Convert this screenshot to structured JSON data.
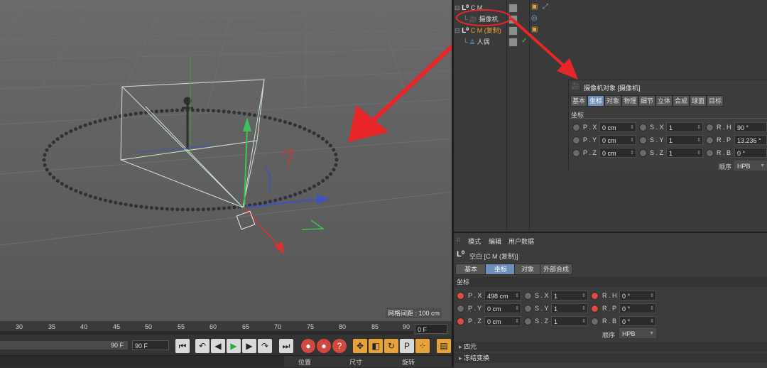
{
  "viewport": {
    "grid_spacing_label": "网格间距 : 100 cm"
  },
  "timeline": {
    "ticks": [
      "30",
      "35",
      "40",
      "45",
      "50",
      "55",
      "60",
      "65",
      "70",
      "75",
      "80",
      "85",
      "90"
    ],
    "current_frame": "0 F",
    "range_bar_value": "90 F",
    "range_end": "90 F"
  },
  "transport": {
    "buttons": [
      "go-start",
      "prev-key",
      "prev-frame",
      "play",
      "next-frame",
      "next-key",
      "go-end"
    ]
  },
  "coord_header": {
    "position": "位置",
    "size": "尺寸",
    "rotation": "旋转"
  },
  "object_manager": {
    "rows": [
      {
        "name": "C M",
        "highlight": false
      },
      {
        "name": "摄像机",
        "highlight": false
      },
      {
        "name": "C M (复制)",
        "highlight": true
      },
      {
        "name": "人偶",
        "highlight": false
      }
    ]
  },
  "camera_panel": {
    "title": "摄像机对象 [摄像机]",
    "tabs": [
      "基本",
      "坐标",
      "对象",
      "物理",
      "细节",
      "立体",
      "合成",
      "球面",
      "目标"
    ],
    "selected_tab": 1,
    "section": "坐标",
    "fields": {
      "px_label": "P . X",
      "px": "0 cm",
      "py_label": "P . Y",
      "py": "0 cm",
      "pz_label": "P . Z",
      "pz": "0 cm",
      "sx_label": "S . X",
      "sx": "1",
      "sy_label": "S . Y",
      "sy": "1",
      "sz_label": "S . Z",
      "sz": "1",
      "rh_label": "R . H",
      "rh": "90 °",
      "rp_label": "R . P",
      "rp": "13.236 °",
      "rb_label": "R . B",
      "rb": "0 °"
    },
    "order_label": "顺序",
    "order_value": "HPB"
  },
  "attribute_manager": {
    "menu": [
      "模式",
      "编辑",
      "用户数据"
    ],
    "object_title": "空白 [C M (复制)]",
    "tabs": [
      "基本",
      "坐标",
      "对象",
      "外部合成"
    ],
    "selected_tab": 1,
    "section": "坐标",
    "fields": {
      "px_label": "P . X",
      "px": "498 cm",
      "py_label": "P . Y",
      "py": "0 cm",
      "pz_label": "P . Z",
      "pz": "0 cm",
      "sx_label": "S . X",
      "sx": "1",
      "sy_label": "S . Y",
      "sy": "1",
      "sz_label": "S . Z",
      "sz": "1",
      "rh_label": "R . H",
      "rh": "0 °",
      "rp_label": "R . P",
      "rp": "0 °",
      "rb_label": "R . B",
      "rb": "0 °"
    },
    "order_label": "顺序",
    "order_value": "HPB",
    "collapsed_sections": [
      "四元",
      "冻结变换"
    ]
  },
  "colors": {
    "selected_tab": "#6f8fb8",
    "annotation_red": "#e8262a",
    "highlight_name": "#e8a23a"
  }
}
